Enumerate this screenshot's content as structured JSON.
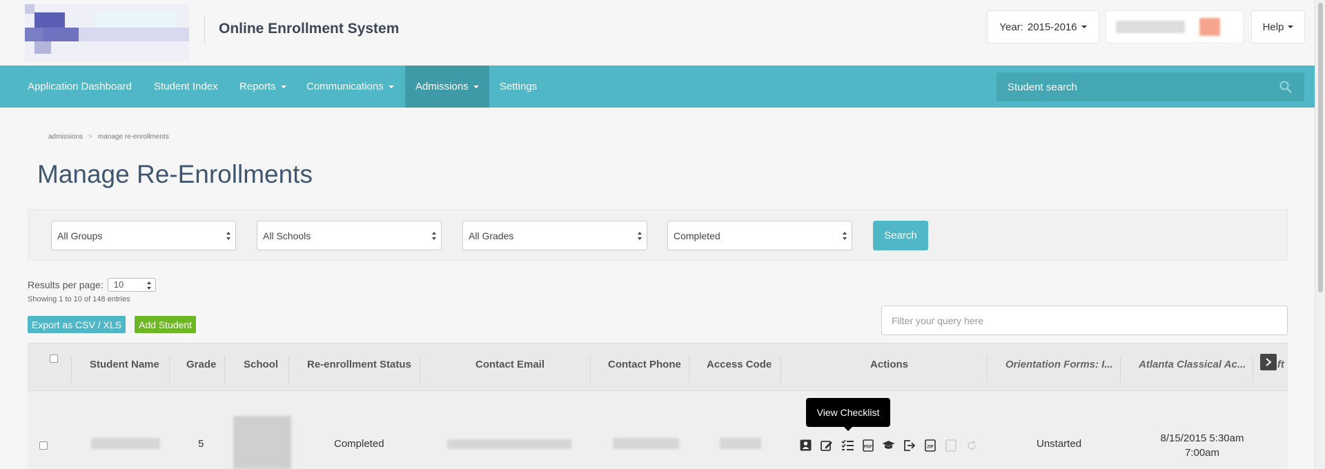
{
  "header": {
    "app_title": "Online Enrollment System",
    "year_label": "Year:",
    "year_value": "2015-2016",
    "help_label": "Help"
  },
  "nav": {
    "items": [
      {
        "label": "Application Dashboard"
      },
      {
        "label": "Student Index"
      },
      {
        "label": "Reports"
      },
      {
        "label": "Communications"
      },
      {
        "label": "Admissions"
      },
      {
        "label": "Settings"
      }
    ],
    "search_placeholder": "Student search"
  },
  "breadcrumb": {
    "items": [
      "admissions",
      "manage re-enrollments"
    ],
    "separator": ">"
  },
  "page": {
    "title": "Manage Re-Enrollments"
  },
  "filters": {
    "groups": "All Groups",
    "schools": "All Schools",
    "grades": "All Grades",
    "status": "Completed",
    "search_button": "Search"
  },
  "results": {
    "per_page_label": "Results per page:",
    "per_page_value": "10",
    "showing": "Showing 1 to 10 of 148 entries",
    "export_label": "Export as CSV / XLS",
    "add_student_label": "Add Student",
    "filter_placeholder": "Filter your query here"
  },
  "table": {
    "headers": [
      "Student Name",
      "Grade",
      "School",
      "Re-enrollment Status",
      "Contact Email",
      "Contact Phone",
      "Access Code",
      "Actions",
      "Orientation Forms: I...",
      "Atlanta Classical Ac...",
      "Aft"
    ],
    "rows": [
      {
        "grade": "5",
        "status": "Completed",
        "orientation": "Unstarted",
        "atlanta_line1": "8/15/2015 5:30am",
        "atlanta_line2": "7:00am"
      }
    ],
    "tooltip": "View Checklist"
  },
  "colors": {
    "accent": "#4fb7c6",
    "accent_dark": "#3f9aa7",
    "add_green": "#6cb723",
    "title_color": "#3f5670"
  }
}
